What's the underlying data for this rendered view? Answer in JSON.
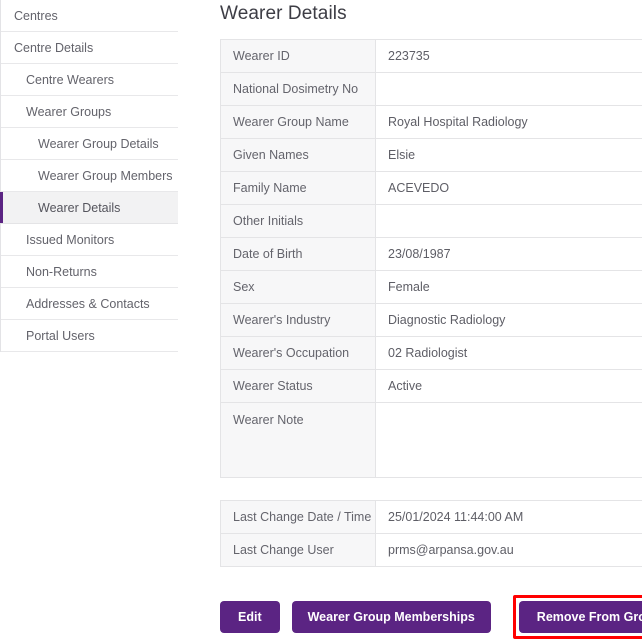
{
  "sidebar": {
    "items": [
      {
        "label": "Centres",
        "level": 0,
        "active": false
      },
      {
        "label": "Centre Details",
        "level": 0,
        "active": false
      },
      {
        "label": "Centre Wearers",
        "level": 1,
        "active": false
      },
      {
        "label": "Wearer Groups",
        "level": 1,
        "active": false
      },
      {
        "label": "Wearer Group Details",
        "level": 2,
        "active": false
      },
      {
        "label": "Wearer Group Members",
        "level": 2,
        "active": false
      },
      {
        "label": "Wearer Details",
        "level": 2,
        "active": true
      },
      {
        "label": "Issued Monitors",
        "level": 1,
        "active": false
      },
      {
        "label": "Non-Returns",
        "level": 1,
        "active": false
      },
      {
        "label": "Addresses & Contacts",
        "level": 1,
        "active": false
      },
      {
        "label": "Portal Users",
        "level": 1,
        "active": false
      }
    ]
  },
  "main": {
    "title": "Wearer Details",
    "details": [
      {
        "label": "Wearer ID",
        "value": "223735",
        "tall": false
      },
      {
        "label": "National Dosimetry No",
        "value": "",
        "tall": false
      },
      {
        "label": "Wearer Group Name",
        "value": "Royal Hospital Radiology",
        "tall": false
      },
      {
        "label": "Given Names",
        "value": "Elsie",
        "tall": false
      },
      {
        "label": "Family Name",
        "value": "ACEVEDO",
        "tall": false
      },
      {
        "label": "Other Initials",
        "value": "",
        "tall": false
      },
      {
        "label": "Date of Birth",
        "value": "23/08/1987",
        "tall": false
      },
      {
        "label": "Sex",
        "value": "Female",
        "tall": false
      },
      {
        "label": "Wearer's Industry",
        "value": "Diagnostic Radiology",
        "tall": false
      },
      {
        "label": "Wearer's Occupation",
        "value": "02 Radiologist",
        "tall": false
      },
      {
        "label": "Wearer Status",
        "value": "Active",
        "tall": false
      },
      {
        "label": "Wearer Note",
        "value": "",
        "tall": true
      }
    ],
    "audit": [
      {
        "label": "Last Change Date / Time",
        "value": "25/01/2024 11:44:00 AM",
        "tall": false
      },
      {
        "label": "Last Change User",
        "value": "prms@arpansa.gov.au",
        "tall": false
      }
    ],
    "buttons": {
      "edit": "Edit",
      "memberships": "Wearer Group Memberships",
      "remove": "Remove From Group"
    }
  },
  "colors": {
    "brand_purple": "#5b2483",
    "highlight_red": "#ff0000",
    "label_cell_bg": "#f7f7f8",
    "border": "#e4e4e6",
    "active_nav_bg": "#f2f2f3"
  }
}
